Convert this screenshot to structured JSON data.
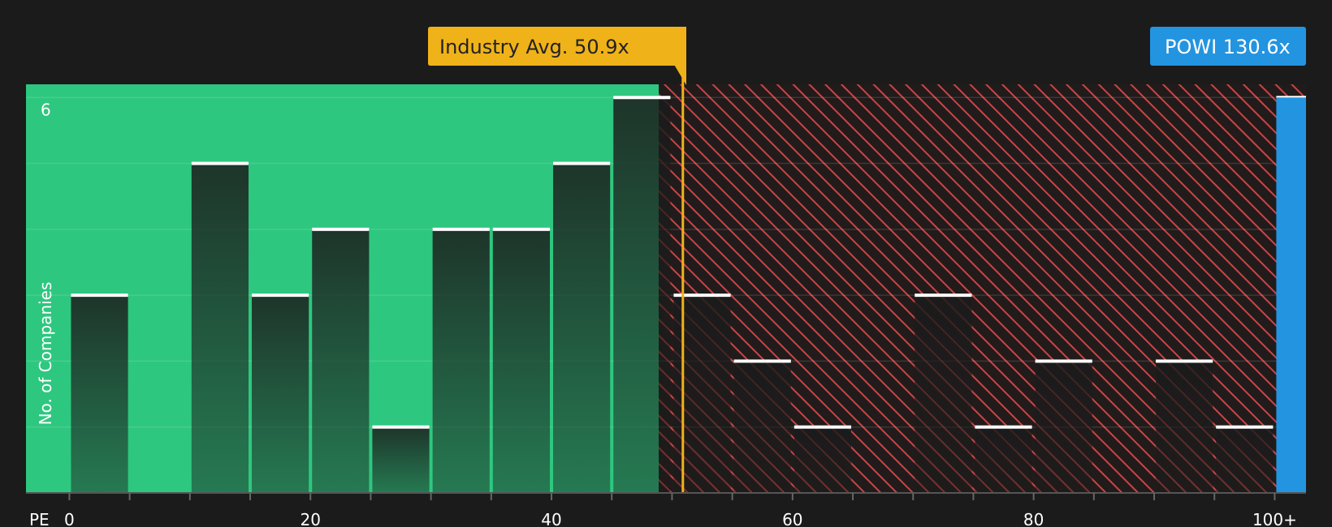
{
  "chart_data": {
    "type": "bar",
    "x_axis_label": "PE",
    "y_axis_label": "No. of Companies",
    "x_ticks": [
      {
        "value": 0,
        "label": "0"
      },
      {
        "value": 20,
        "label": "20"
      },
      {
        "value": 40,
        "label": "40"
      },
      {
        "value": 60,
        "label": "60"
      },
      {
        "value": 80,
        "label": "80"
      },
      {
        "value": 100,
        "label": "100+"
      }
    ],
    "y_ticks": [
      {
        "value": 6,
        "label": "6"
      }
    ],
    "xlim": [
      -3.6,
      102.6
    ],
    "ylim": [
      0,
      6.2
    ],
    "bin_width": 5,
    "bins": [
      {
        "x0": 0,
        "count": 3
      },
      {
        "x0": 5,
        "count": 0
      },
      {
        "x0": 10,
        "count": 5
      },
      {
        "x0": 15,
        "count": 3
      },
      {
        "x0": 20,
        "count": 4
      },
      {
        "x0": 25,
        "count": 1
      },
      {
        "x0": 30,
        "count": 4
      },
      {
        "x0": 35,
        "count": 4
      },
      {
        "x0": 40,
        "count": 5
      },
      {
        "x0": 45,
        "count": 6
      },
      {
        "x0": 50,
        "count": 3
      },
      {
        "x0": 55,
        "count": 2
      },
      {
        "x0": 60,
        "count": 1
      },
      {
        "x0": 65,
        "count": 0
      },
      {
        "x0": 70,
        "count": 3
      },
      {
        "x0": 75,
        "count": 1
      },
      {
        "x0": 80,
        "count": 2
      },
      {
        "x0": 85,
        "count": 0
      },
      {
        "x0": 90,
        "count": 2
      },
      {
        "x0": 95,
        "count": 1
      },
      {
        "x0": 100,
        "count": 6
      }
    ],
    "industry_avg": {
      "value": 50.9,
      "label": "Industry Avg. 50.9x"
    },
    "company": {
      "value": 130.6,
      "label": "POWI 130.6x"
    },
    "fair_zone_end": 48.9,
    "colors": {
      "background": "#1b1b1b",
      "fair_zone": "#2ec77f",
      "expensive_zone": "#c94545",
      "bar_fill": "#1f3a2e",
      "bar_cap": "#ffffff",
      "industry": "#f0b219",
      "company": "#2394e0"
    }
  }
}
